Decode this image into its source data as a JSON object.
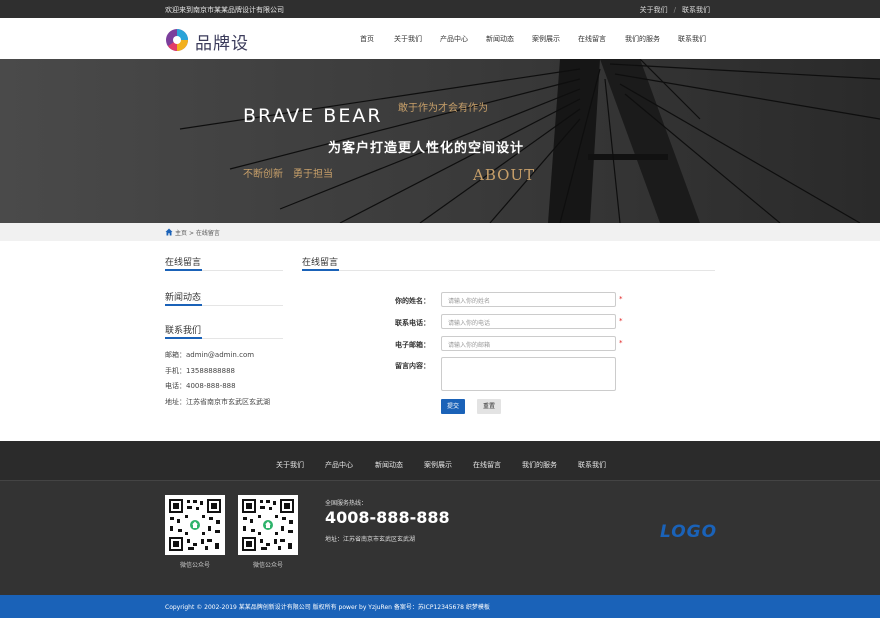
{
  "topbar": {
    "welcome": "欢迎来到南京市某某品牌设计有限公司",
    "links": [
      "关于我们",
      "联系我们"
    ],
    "separator": "/"
  },
  "header": {
    "logo_text": "品牌设计",
    "nav": [
      "首页",
      "关于我们",
      "产品中心",
      "新闻动态",
      "案例展示",
      "在线留言",
      "我们的服务",
      "联系我们"
    ]
  },
  "banner": {
    "title": "BRAVE BEAR",
    "sub1": "敢于作为才会有作为",
    "main": "为客户打造更人性化的空间设计",
    "sub2": "不断创新　勇于担当",
    "about": "ABOUT"
  },
  "breadcrumb": {
    "home": "主页",
    "sep": ">",
    "current": "在线留言"
  },
  "sidebar": {
    "sections": [
      "在线留言",
      "新闻动态",
      "联系我们"
    ],
    "contact": [
      "邮箱：admin@admin.com",
      "手机：13588888888",
      "电话：4008-888-888",
      "地址：江苏省南京市玄武区玄武湖"
    ]
  },
  "main": {
    "title": "在线留言",
    "form": {
      "name_label": "你的姓名：",
      "name_placeholder": "请输入你的姓名",
      "phone_label": "联系电话：",
      "phone_placeholder": "请输入你的电话",
      "email_label": "电子邮箱：",
      "email_placeholder": "请输入你的邮箱",
      "message_label": "留言内容：",
      "required_mark": "*",
      "submit": "提交",
      "reset": "重置"
    }
  },
  "footer": {
    "nav": [
      "关于我们",
      "产品中心",
      "新闻动态",
      "案例展示",
      "在线留言",
      "我们的服务",
      "联系我们"
    ],
    "qr_captions": [
      "微信公众号",
      "微信公众号"
    ],
    "hotline_label": "全国服务热线：",
    "hotline": "4008-888-888",
    "address": "地址：江苏省南京市玄武区玄武湖",
    "logo": "LOGO",
    "copyright": "Copyright © 2002-2019 某某品牌创新设计有限公司 版权所有 power by YzjuRen 备案号：苏ICP12345678 织梦模板"
  },
  "colors": {
    "accent": "#1a62b8",
    "gold": "#c8a06a",
    "dark": "#2f2f2f"
  }
}
